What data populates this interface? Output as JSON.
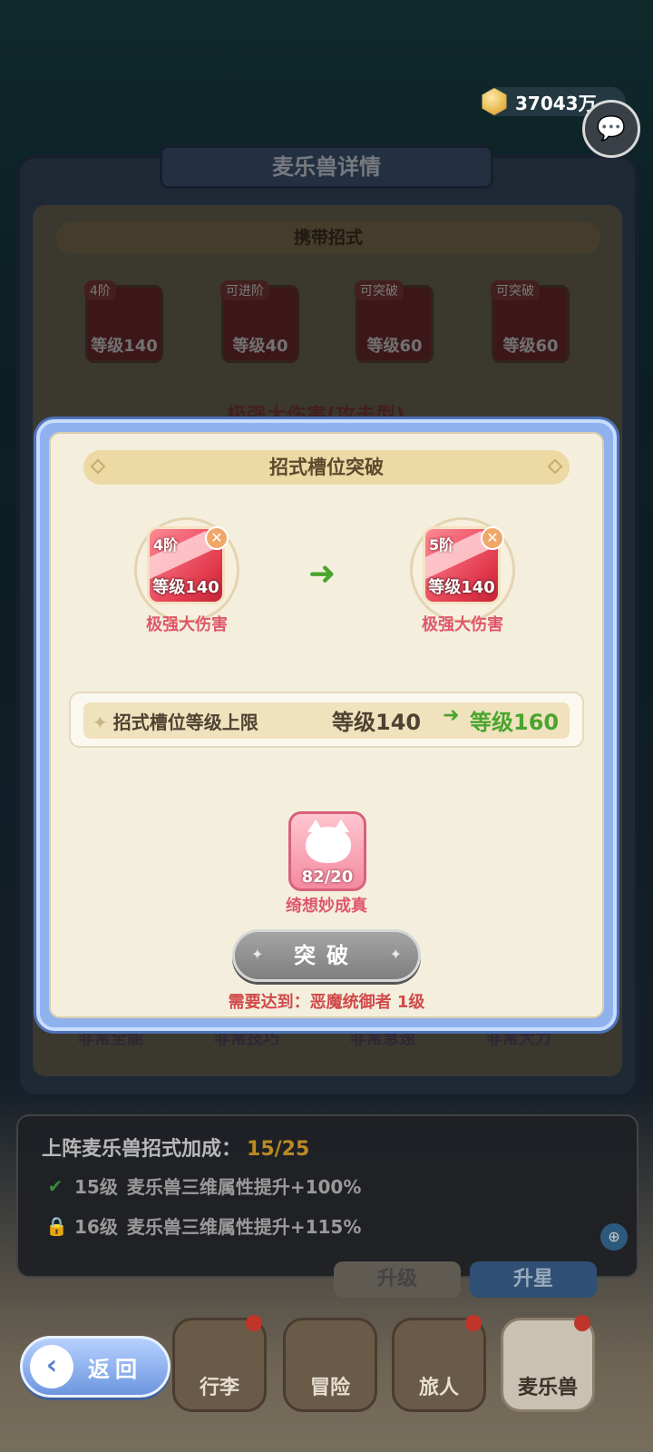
{
  "currency": {
    "amount": "37043万",
    "icon": "gold-coin-icon"
  },
  "chat": {
    "icon": "chat-bubbles-icon"
  },
  "underlay": {
    "header": "麦乐兽详情",
    "section": "携带招式",
    "skills": [
      {
        "tag": "4阶",
        "level": "等级140"
      },
      {
        "tag": "可进阶",
        "level": "等级40"
      },
      {
        "tag": "可突破",
        "level": "等级60"
      },
      {
        "tag": "可突破",
        "level": "等级60"
      }
    ],
    "skill_title": "极强大伤害(攻击型)",
    "attrs": [
      "非常全能",
      "非常技巧",
      "非常急速",
      "非常大力"
    ],
    "buttons": {
      "upgrade": "升级",
      "upstar": "升星"
    }
  },
  "bonus": {
    "title": "上阵麦乐兽招式加成：",
    "count": "15/25",
    "lines": [
      {
        "level": "15级",
        "text": "麦乐兽三维属性提升+100%",
        "state": "unlocked"
      },
      {
        "level": "16级",
        "text": "麦乐兽三维属性提升+115%",
        "state": "locked"
      }
    ]
  },
  "modal": {
    "title": "招式槽位突破",
    "before": {
      "tier": "4阶",
      "level": "等级140",
      "name": "极强大伤害"
    },
    "after": {
      "tier": "5阶",
      "level": "等级140",
      "name": "极强大伤害"
    },
    "arrow": "➜",
    "limit": {
      "label": "招式槽位等级上限",
      "from": "等级140",
      "to": "等级160",
      "arrow": "➜"
    },
    "material": {
      "count": "82/20",
      "name": "绮想妙成真"
    },
    "button": "突破",
    "requirement": "需要达到：恶魔统御者 1级"
  },
  "nav": {
    "back": "返回",
    "items": [
      {
        "label": "行李",
        "dot": true
      },
      {
        "label": "冒险",
        "dot": false
      },
      {
        "label": "旅人",
        "dot": true
      },
      {
        "label": "麦乐兽",
        "dot": true
      }
    ]
  }
}
